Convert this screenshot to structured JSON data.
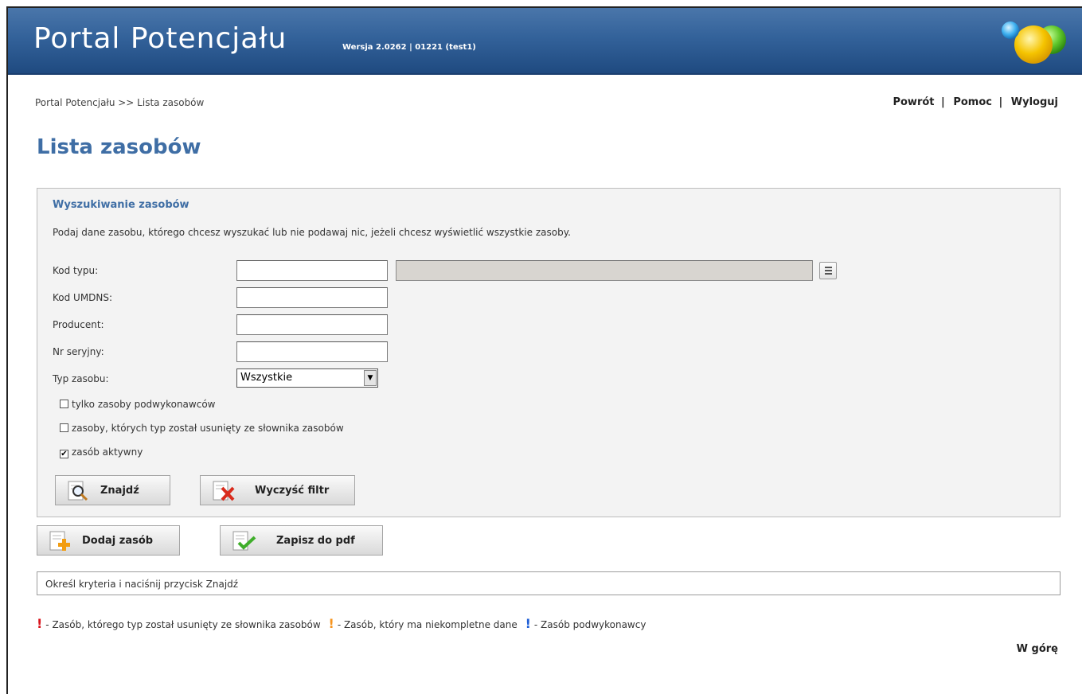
{
  "header": {
    "app_title": "Portal Potencjału",
    "version": "Wersja 2.0262 | 01221 (test1)"
  },
  "breadcrumb": "Portal Potencjału >> Lista zasobów",
  "top_links": {
    "back": "Powrót",
    "help": "Pomoc",
    "logout": "Wyloguj",
    "separator": "|"
  },
  "page_title": "Lista zasobów",
  "search": {
    "title": "Wyszukiwanie zasobów",
    "description": "Podaj dane zasobu, którego chcesz wyszukać lub nie podawaj nic, jeżeli chcesz wyświetlić wszystkie zasoby.",
    "fields": {
      "type_code": {
        "label": "Kod typu:",
        "value": "",
        "description_value": ""
      },
      "umdns_code": {
        "label": "Kod UMDNS:",
        "value": ""
      },
      "producer": {
        "label": "Producent:",
        "value": ""
      },
      "serial_no": {
        "label": "Nr seryjny:",
        "value": ""
      },
      "resource_type": {
        "label": "Typ zasobu:",
        "selected": "Wszystkie"
      }
    },
    "checkboxes": [
      {
        "label": "tylko zasoby podwykonawców",
        "checked": false
      },
      {
        "label": "zasoby, których typ został usunięty ze słownika zasobów",
        "checked": false
      },
      {
        "label": "zasób aktywny",
        "checked": true
      }
    ],
    "buttons": {
      "find": "Znajdź",
      "clear": "Wyczyść filtr"
    }
  },
  "actions": {
    "add": "Dodaj zasób",
    "pdf": "Zapisz do pdf"
  },
  "status_message": "Określ kryteria i naciśnij przycisk Znajdź",
  "legend": [
    {
      "mark": "!",
      "color": "#d9141c",
      "text": "- Zasób, którego typ został usunięty ze słownika zasobów"
    },
    {
      "mark": "!",
      "color": "#f7941d",
      "text": "- Zasób, który ma niekompletne dane"
    },
    {
      "mark": "!",
      "color": "#1f5fd6",
      "text": "- Zasób podwykonawcy"
    }
  ],
  "up_link": "W górę",
  "colors": {
    "header_blue": "#33629a",
    "title_blue": "#3f6ea5"
  }
}
